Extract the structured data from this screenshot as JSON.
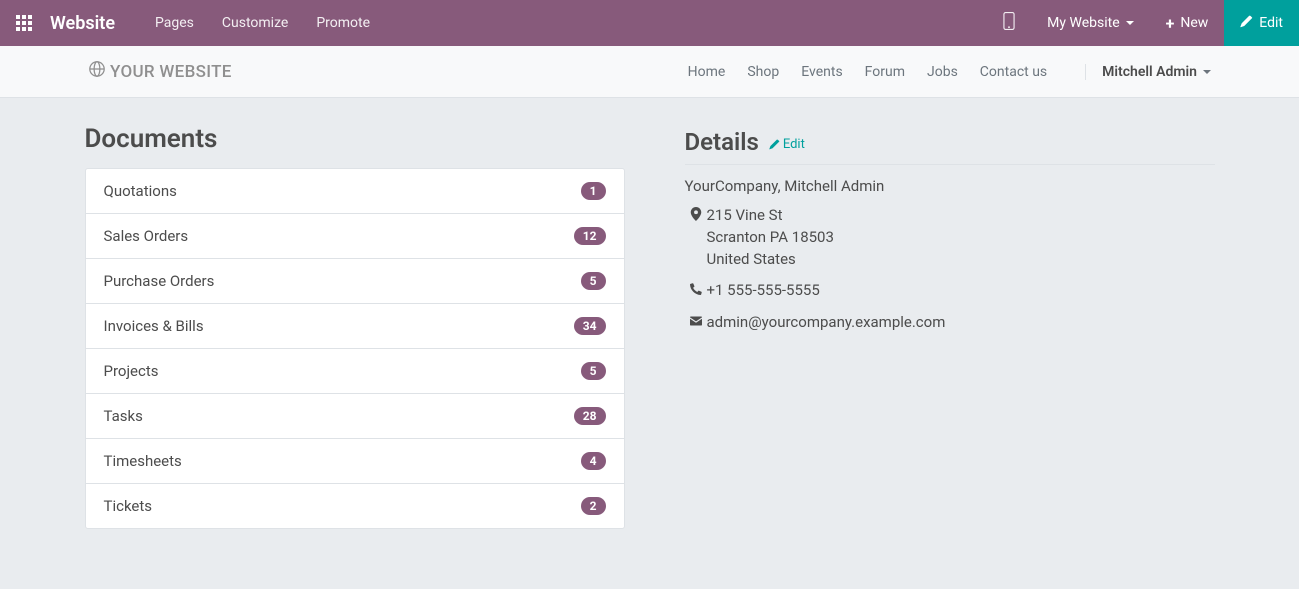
{
  "topbar": {
    "brand": "Website",
    "menu": [
      "Pages",
      "Customize",
      "Promote"
    ],
    "site_switcher": "My Website",
    "new_label": "New",
    "edit_label": "Edit"
  },
  "navbar": {
    "logo_text": "YOUR WEBSITE",
    "links": [
      "Home",
      "Shop",
      "Events",
      "Forum",
      "Jobs",
      "Contact us"
    ],
    "user": "Mitchell Admin"
  },
  "documents": {
    "title": "Documents",
    "items": [
      {
        "label": "Quotations",
        "count": "1"
      },
      {
        "label": "Sales Orders",
        "count": "12"
      },
      {
        "label": "Purchase Orders",
        "count": "5"
      },
      {
        "label": "Invoices & Bills",
        "count": "34"
      },
      {
        "label": "Projects",
        "count": "5"
      },
      {
        "label": "Tasks",
        "count": "28"
      },
      {
        "label": "Timesheets",
        "count": "4"
      },
      {
        "label": "Tickets",
        "count": "2"
      }
    ]
  },
  "details": {
    "title": "Details",
    "edit_label": "Edit",
    "company_line": "YourCompany, Mitchell Admin",
    "address_line1": "215 Vine St",
    "address_line2": "Scranton PA 18503",
    "address_line3": "United States",
    "phone": "+1 555-555-5555",
    "email": "admin@yourcompany.example.com"
  }
}
